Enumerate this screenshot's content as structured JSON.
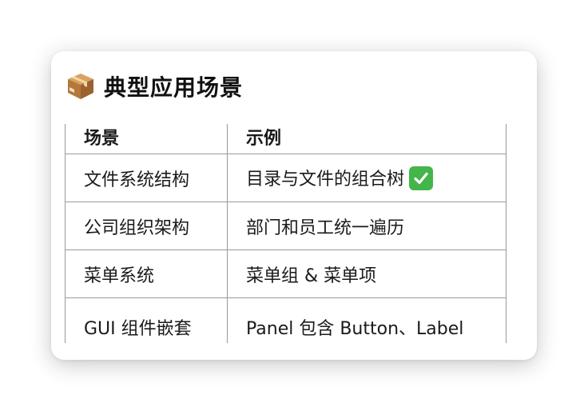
{
  "section": {
    "icon": "package-icon",
    "title": "典型应用场景"
  },
  "table": {
    "headers": [
      "场景",
      "示例"
    ],
    "rows": [
      {
        "scene": "文件系统结构",
        "example": "目录与文件的组合树",
        "badge": "check-mark-icon"
      },
      {
        "scene": "公司组织架构",
        "example": "部门和员工统一遍历"
      },
      {
        "scene": "菜单系统",
        "example": "菜单组 & 菜单项"
      },
      {
        "scene": "GUI 组件嵌套",
        "example": "Panel 包含 Button、Label"
      }
    ]
  },
  "colors": {
    "check_bg": "#43b54a",
    "border": "#9a9a9a"
  }
}
